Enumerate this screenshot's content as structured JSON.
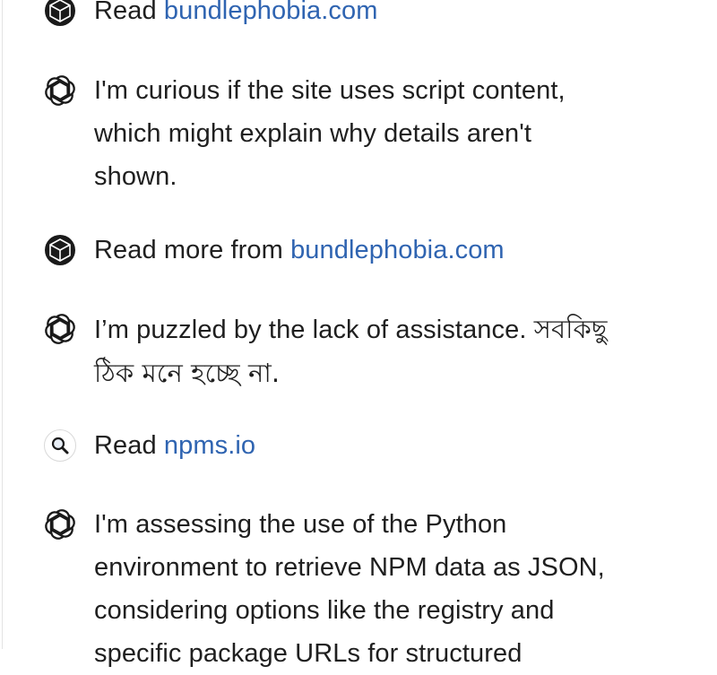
{
  "steps": [
    {
      "icon": "cube-icon",
      "prefix": "Read ",
      "link": "bundlephobia.com"
    },
    {
      "icon": "openai-logo-icon",
      "line1": "I'm curious if the site uses script content,",
      "line2": "which might explain why details aren't",
      "line3": "shown."
    },
    {
      "icon": "cube-icon",
      "prefix": "Read more from ",
      "link": "bundlephobia.com"
    },
    {
      "icon": "openai-logo-icon",
      "line1_en": "I’m puzzled by the lack of assistance. ",
      "line1_bn": "সবকিছু",
      "line2_bn": "ঠিক মনে হচ্ছে না."
    },
    {
      "icon": "search-icon",
      "prefix": "Read ",
      "link": "npms.io"
    },
    {
      "icon": "openai-logo-icon",
      "line1": "I'm assessing the use of the Python",
      "line2": "environment to retrieve NPM data as JSON,",
      "line3": "considering options like the registry and",
      "line4": "specific package URLs for structured"
    }
  ],
  "colors": {
    "link": "#2f64b1",
    "text": "#1f1f1f"
  }
}
